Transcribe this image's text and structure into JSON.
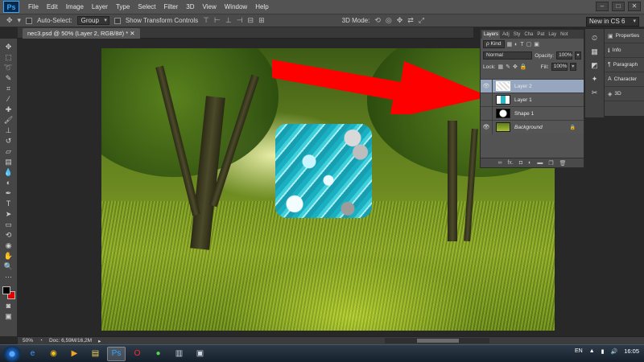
{
  "app": {
    "logo": "Ps",
    "menu": [
      "File",
      "Edit",
      "Image",
      "Layer",
      "Type",
      "Select",
      "Filter",
      "3D",
      "View",
      "Window",
      "Help"
    ],
    "window_controls": [
      "–",
      "□",
      "✕"
    ]
  },
  "options_bar": {
    "auto_select_label": "Auto-Select:",
    "auto_select_mode": "Group",
    "show_transform_label": "Show Transform Controls",
    "mode_3d_label": "3D Mode:",
    "workspace": "New in CS 6"
  },
  "document": {
    "tab_title": "nec3.psd @ 50% (Layer 2, RGB/8#) * ✕"
  },
  "layers_panel": {
    "tabs": [
      "Layers",
      "Adj",
      "Sty",
      "Cha",
      "Pat",
      "Lay",
      "Not"
    ],
    "kind_label": "ρ Kind",
    "blend_mode": "Normal",
    "opacity_label": "Opacity:",
    "opacity_value": "100%",
    "lock_label": "Lock:",
    "fill_label": "Fill:",
    "fill_value": "100%",
    "layers": [
      {
        "name": "Layer 2",
        "visible": true,
        "selected": true
      },
      {
        "name": "Layer 1",
        "visible": false,
        "selected": false
      },
      {
        "name": "Shape 1",
        "visible": false,
        "selected": false
      },
      {
        "name": "Background",
        "visible": true,
        "selected": false,
        "locked": true
      }
    ],
    "footer_icons": [
      "link-icon",
      "fx-icon",
      "mask-icon",
      "adjustment-icon",
      "folder-icon",
      "new-layer-icon",
      "trash-icon"
    ],
    "footer_fx": "fx."
  },
  "side_panels": {
    "items": [
      "Properties",
      "Info",
      "Paragraph",
      "Character",
      "3D"
    ]
  },
  "status_bar": {
    "zoom": "50%",
    "doc_size": "Doc: 6,59M/16,2M"
  },
  "taskbar": {
    "language": "EN",
    "time": "16:05"
  },
  "colors": {
    "foreground": "#000000",
    "background": "#e00000",
    "arrow": "#ff0000",
    "selected_layer": "#96a6bf"
  }
}
